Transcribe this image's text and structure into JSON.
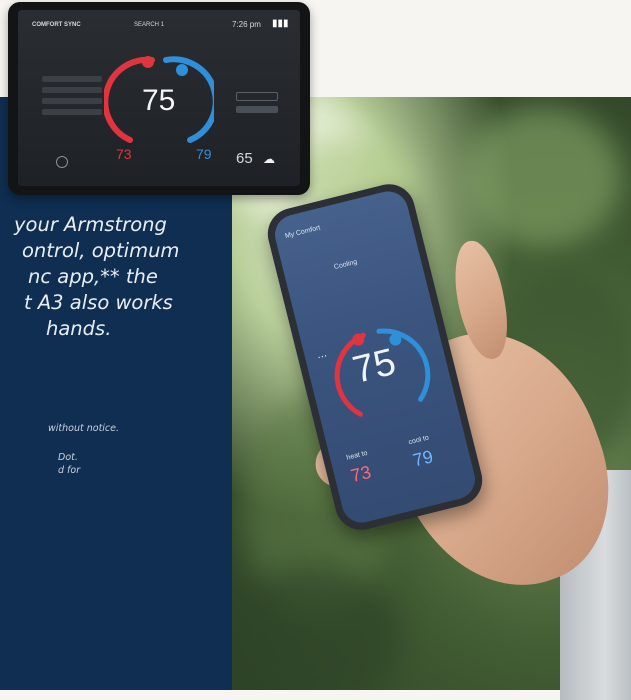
{
  "body_text": {
    "line1": "your Armstrong",
    "line2": "ontrol, optimum",
    "line3": "nc app,** the",
    "line4": "t A3 also works",
    "line5": "hands."
  },
  "notes": {
    "note1": "without notice.",
    "note2": "Dot.",
    "note3": "d for"
  },
  "tablet": {
    "brand": "COMFORT SYNC",
    "zone": "SEARCH 1",
    "time": "7:26 pm",
    "temperature": "75",
    "heat_setpoint": "73",
    "cool_setpoint": "79",
    "outdoor_temp": "65"
  },
  "phone": {
    "title": "My Comfort",
    "mode": "Cooling",
    "temperature": "75",
    "heat_label": "heat to",
    "cool_label": "cool to",
    "heat_setpoint": "73",
    "cool_setpoint": "79"
  },
  "colors": {
    "navy": "#0f2e52",
    "heat_red": "#e0343f",
    "cool_blue": "#2f8fd8"
  }
}
